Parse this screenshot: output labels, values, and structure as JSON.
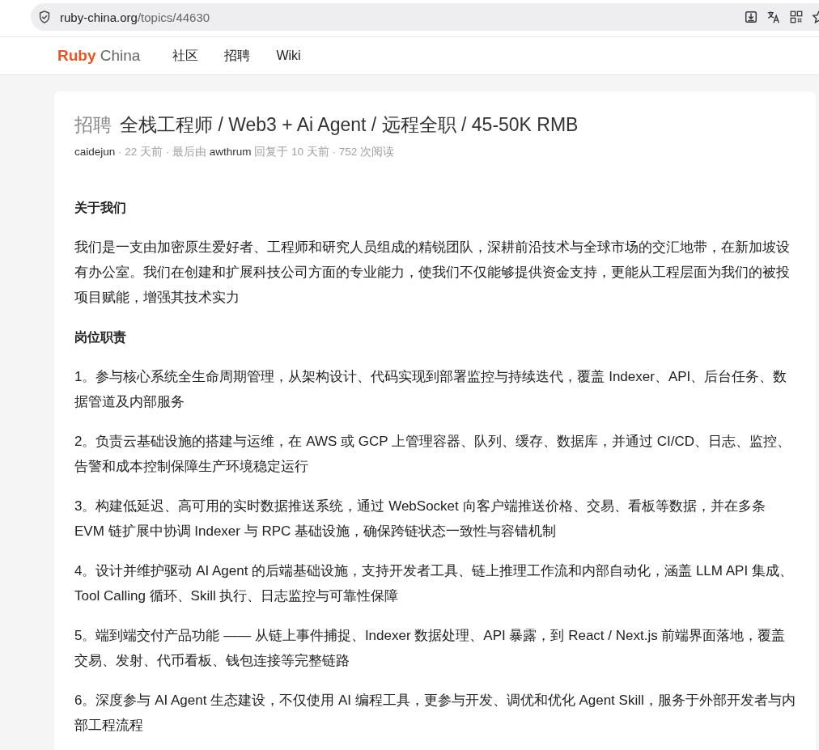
{
  "browser": {
    "url_host": "ruby-china.org",
    "url_path": "/topics/44630"
  },
  "nav": {
    "logo_primary": "Ruby",
    "logo_secondary": "China",
    "links": [
      {
        "label": "社区"
      },
      {
        "label": "招聘"
      },
      {
        "label": "Wiki"
      }
    ]
  },
  "topic": {
    "node": "招聘",
    "title": "全栈工程师 / Web3 + Ai Agent / 远程全职 / 45-50K RMB",
    "meta": [
      {
        "kind": "user",
        "text": "caidejun"
      },
      {
        "kind": "text",
        "text": " · 22 天前 · 最后由 "
      },
      {
        "kind": "user",
        "text": "awthrum"
      },
      {
        "kind": "text",
        "text": " 回复于 10 天前 · 752 次阅读"
      }
    ],
    "body": [
      {
        "kind": "heading",
        "text": "关于我们"
      },
      {
        "kind": "paragraph",
        "text": "我们是一支由加密原生爱好者、工程师和研究人员组成的精锐团队，深耕前沿技术与全球市场的交汇地带，在新加坡设有办公室。我们在创建和扩展科技公司方面的专业能力，使我们不仅能够提供资金支持，更能从工程层面为我们的被投项目赋能，增强其技术实力"
      },
      {
        "kind": "heading",
        "text": "岗位职责"
      },
      {
        "kind": "paragraph",
        "text": "1。参与核心系统全生命周期管理，从架构设计、代码实现到部署监控与持续迭代，覆盖 Indexer、API、后台任务、数据管道及内部服务"
      },
      {
        "kind": "paragraph",
        "text": "2。负责云基础设施的搭建与运维，在 AWS 或 GCP 上管理容器、队列、缓存、数据库，并通过 CI/CD、日志、监控、告警和成本控制保障生产环境稳定运行"
      },
      {
        "kind": "paragraph",
        "text": "3。构建低延迟、高可用的实时数据推送系统，通过 WebSocket 向客户端推送价格、交易、看板等数据，并在多条 EVM 链扩展中协调 Indexer 与 RPC 基础设施，确保跨链状态一致性与容错机制"
      },
      {
        "kind": "paragraph",
        "text": "4。设计并维护驱动 AI Agent 的后端基础设施，支持开发者工具、链上推理工作流和内部自动化，涵盖 LLM API 集成、Tool Calling 循环、Skill 执行、日志监控与可靠性保障"
      },
      {
        "kind": "paragraph",
        "text": "5。端到端交付产品功能 —— 从链上事件捕捉、Indexer 数据处理、API 暴露，到 React / Next.js 前端界面落地，覆盖交易、发射、代币看板、钱包连接等完整链路"
      },
      {
        "kind": "paragraph",
        "text": "6。深度参与 AI Agent 生态建设，不仅使用 AI 编程工具，更参与开发、调优和优化 Agent Skill，服务于外部开发者与内部工程流程"
      }
    ]
  }
}
